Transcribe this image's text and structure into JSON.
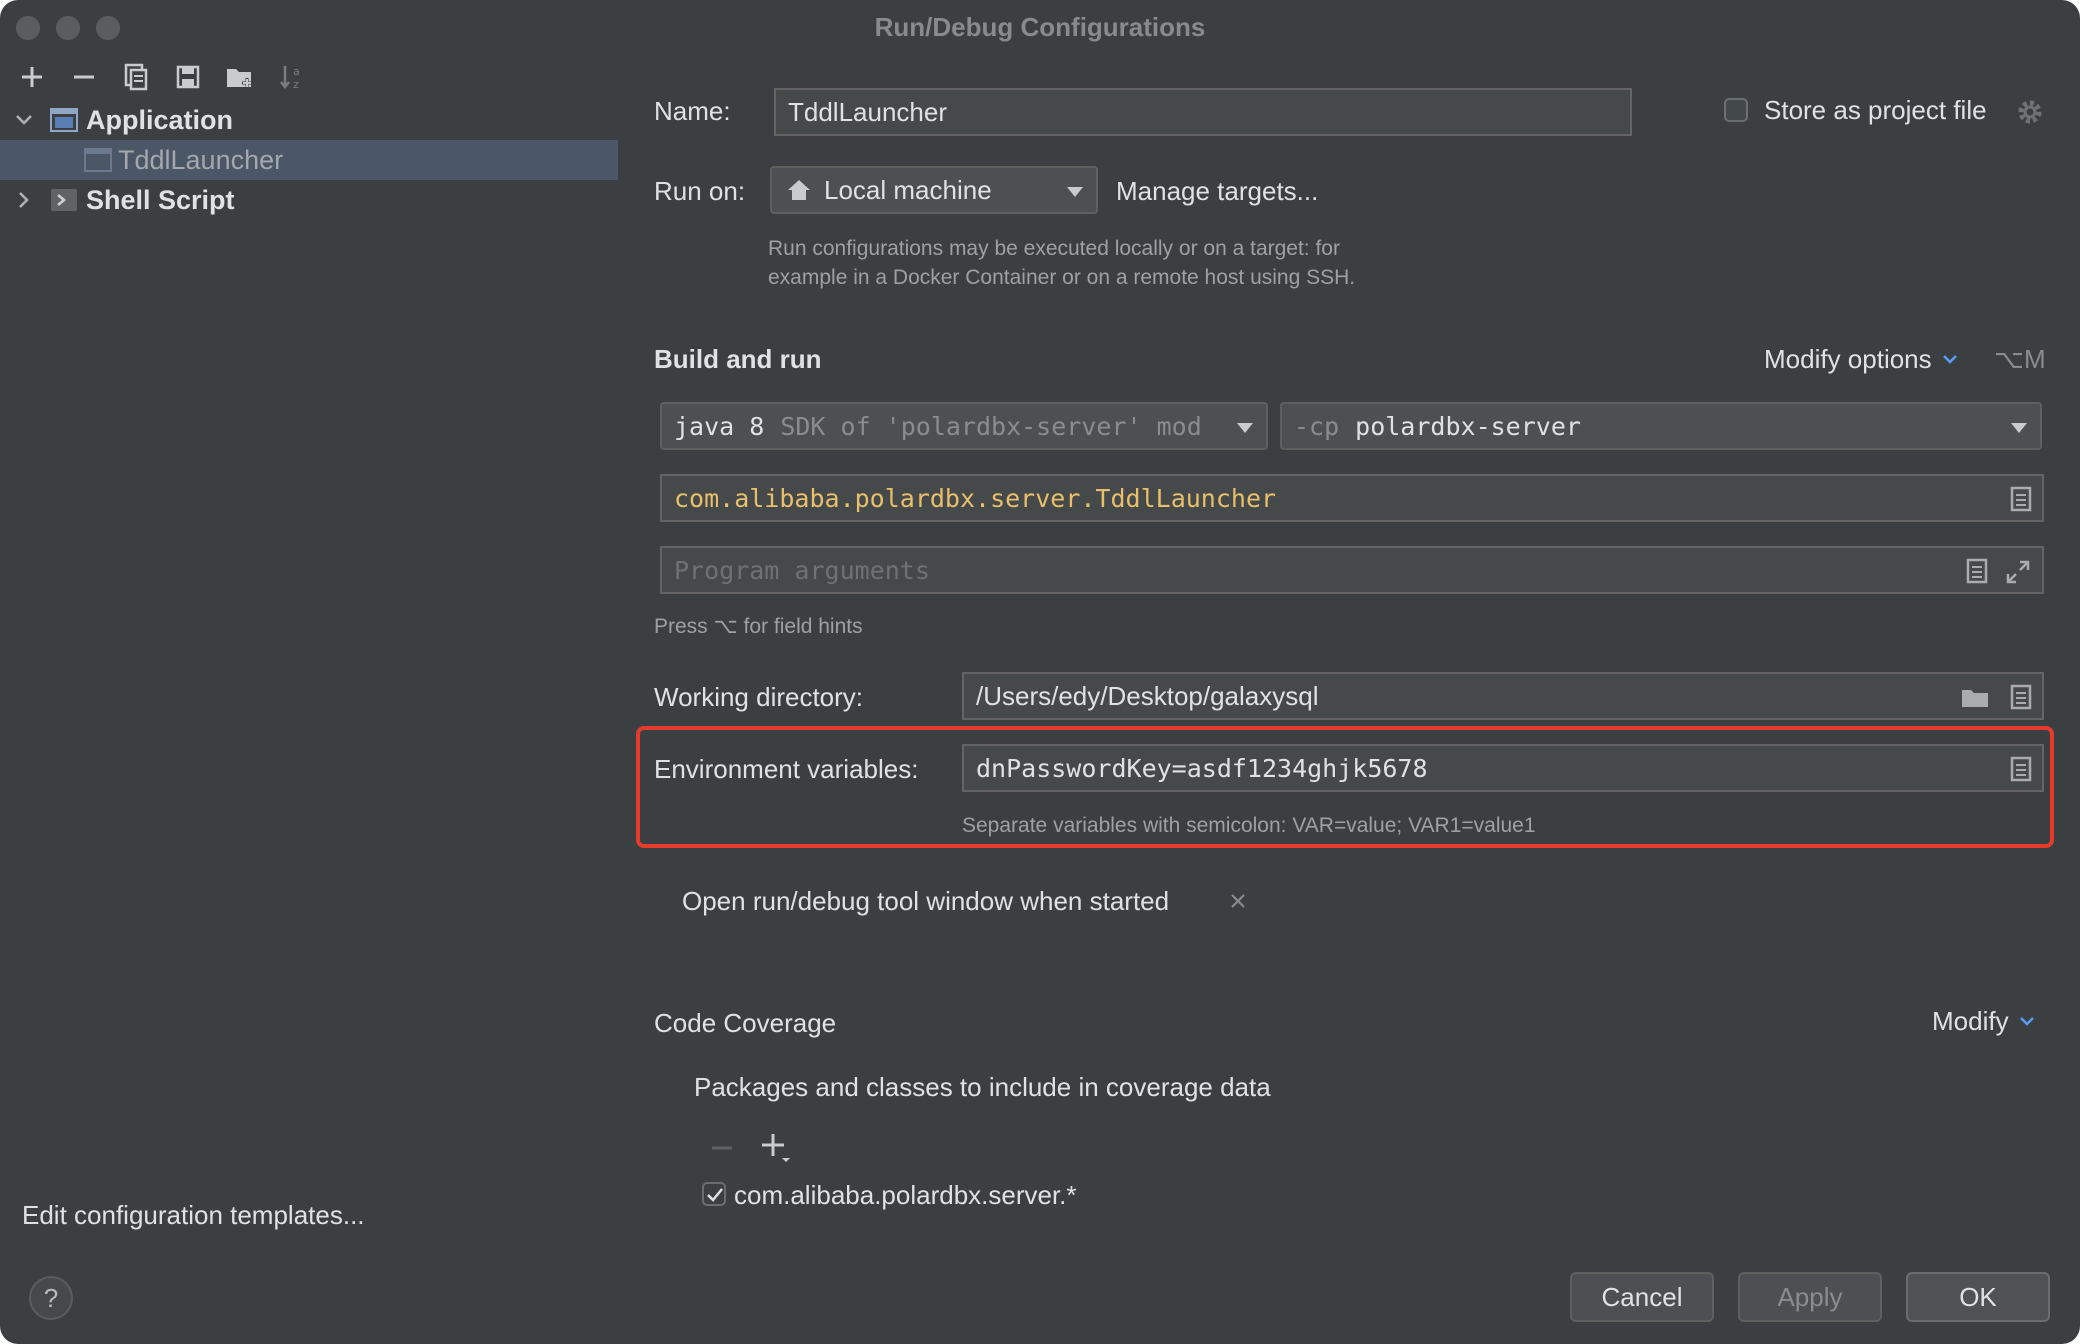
{
  "window": {
    "title": "Run/Debug Configurations"
  },
  "toolbar": {
    "icons": [
      "add-icon",
      "remove-icon",
      "copy-icon",
      "save-icon",
      "new-folder-icon",
      "sort-icon"
    ]
  },
  "tree": {
    "application": "Application",
    "tddl_launcher": "TddlLauncher",
    "shell_script": "Shell Script"
  },
  "left_footer": {
    "edit_templates": "Edit configuration templates...",
    "help": "?"
  },
  "form": {
    "name_label": "Name:",
    "name_value": "TddlLauncher",
    "store_label": "Store as project file",
    "run_on_label": "Run on:",
    "run_on_value": "Local machine",
    "manage_targets": "Manage targets...",
    "run_on_hint_1": "Run configurations may be executed locally or on a target: for",
    "run_on_hint_2": "example in a Docker Container or on a remote host using SSH."
  },
  "build_run": {
    "title": "Build and run",
    "modify_options": "Modify options",
    "modify_shortcut": "⌥M",
    "jdk_main": "java 8",
    "jdk_detail": "SDK of 'polardbx-server' mod",
    "cp_prefix": "-cp",
    "cp_value": "polardbx-server",
    "main_class": "com.alibaba.polardbx.server.TddlLauncher",
    "program_args_placeholder": "Program arguments",
    "field_hints": "Press ⌥ for field hints"
  },
  "working_dir": {
    "label": "Working directory:",
    "value": "/Users/edy/Desktop/galaxysql"
  },
  "env": {
    "label": "Environment variables:",
    "value": "dnPasswordKey=asdf1234ghjk5678",
    "hint": "Separate variables with semicolon: VAR=value; VAR1=value1"
  },
  "open_tool_window": "Open run/debug tool window when started",
  "coverage": {
    "title": "Code Coverage",
    "modify": "Modify",
    "packages_label": "Packages and classes to include in coverage data",
    "package_entry": "com.alibaba.polardbx.server.*"
  },
  "buttons": {
    "cancel": "Cancel",
    "apply": "Apply",
    "ok": "OK"
  },
  "colors": {
    "accent": "#589df6",
    "highlight_box": "#e53b2d",
    "main_class": "#e8bf6a"
  }
}
